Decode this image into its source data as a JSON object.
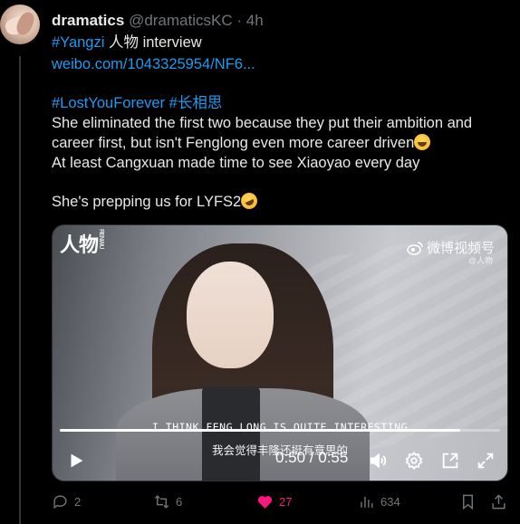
{
  "post": {
    "author": {
      "name": "dramatics",
      "handle": "@dramaticsKC",
      "separator": "·",
      "time": "4h"
    },
    "lines": {
      "l1_tag": "#Yangzi",
      "l1_text": " 人物 interview",
      "l2_link": "weibo.com/1043325954/NF6...",
      "l3_tag1": "#LostYouForever",
      "l3_tag2": "#长相思",
      "l4": "She eliminated the first two because they put their ambition and",
      "l5": "career first, but isn't Fenglong even more career driven",
      "l6": "At least Cangxuan made time to see Xiaoyao every day",
      "l7": "She's prepping us for LYFS2"
    },
    "video": {
      "logo_text": "人物",
      "logo_small": "RENWU",
      "watermark": "微博视频号",
      "watermark_sub": "@人物",
      "subtitle_en": "I THINK FENG LONG IS QUITE INTERESTING",
      "subtitle_zh": "我会觉得丰隆还挺有意思的",
      "time": "0:50 / 0:55",
      "progress": 0.91
    },
    "actions": {
      "replies": "2",
      "reposts": "6",
      "likes": "27",
      "views": "634"
    }
  },
  "icons": {
    "reply": "reply-icon",
    "repost": "repost-icon",
    "like": "heart-icon",
    "views": "views-icon",
    "bookmark": "bookmark-icon",
    "share": "share-icon",
    "play": "play-icon",
    "volume": "volume-icon",
    "settings": "gear-icon",
    "pip": "pip-icon",
    "fullscreen": "fullscreen-icon"
  },
  "colors": {
    "accent": "#1d9bf0",
    "like": "#f91880",
    "muted": "#71767b",
    "text": "#e7e9ea"
  }
}
